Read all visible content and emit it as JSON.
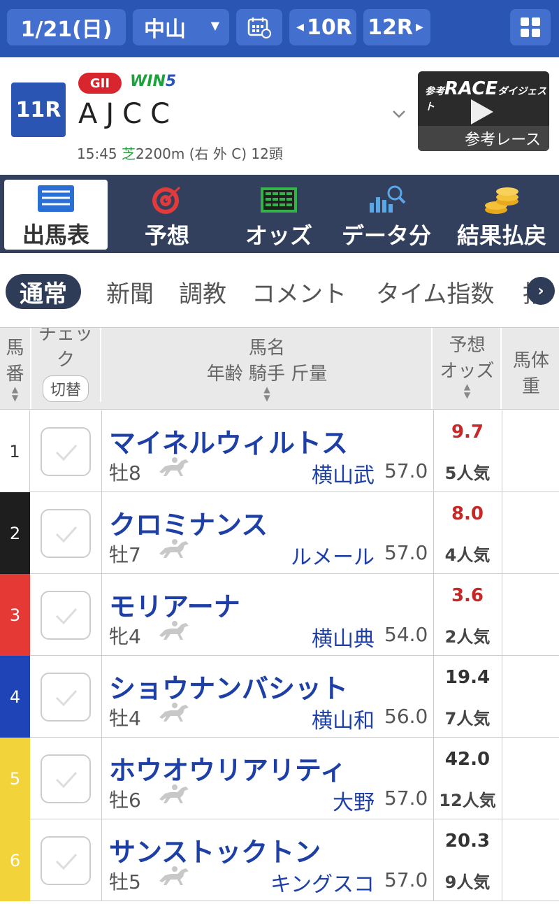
{
  "topbar": {
    "date": "1/21(日)",
    "venue": "中山",
    "prev_race": "10R",
    "next_race": "12R"
  },
  "race": {
    "number": "11R",
    "grade": "GII",
    "win5_prefix": "WIN",
    "win5_num": "5",
    "name": "AJCC",
    "time": "15:45",
    "surface": "芝",
    "info_rest": "2200m (右 外 C) 12頭",
    "thumb_small": "参考",
    "thumb_title": "RACE",
    "thumb_sub": "ダイジェスト",
    "thumb_caption": "参考レース"
  },
  "tabs": [
    "出馬表",
    "予想",
    "オッズ",
    "データ分",
    "結果払戻"
  ],
  "subtabs": [
    "通常",
    "新聞",
    "調教",
    "コメント",
    "タイム指数",
    "指"
  ],
  "table_header": {
    "col1": [
      "馬",
      "番"
    ],
    "col2": [
      "チェッ",
      "ク"
    ],
    "col2_btn": "切替",
    "col3": [
      "馬名",
      "年齢 騎手 斤量"
    ],
    "col4": [
      "予想",
      "オッズ"
    ],
    "col5": [
      "馬体",
      "重"
    ]
  },
  "horses": [
    {
      "num": "1",
      "name": "マイネルウィルトス",
      "sexage": "牡8",
      "jockey": "横山武",
      "weight": "57.0",
      "odds": "9.7",
      "pop": "5人気",
      "hot": true,
      "color": "#ffffff",
      "numcolor": "#333333"
    },
    {
      "num": "2",
      "name": "クロミナンス",
      "sexage": "牡7",
      "jockey": "ルメール",
      "weight": "57.0",
      "odds": "8.0",
      "pop": "4人気",
      "hot": true,
      "color": "#1e1e1e",
      "numcolor": "#ffffff"
    },
    {
      "num": "3",
      "name": "モリアーナ",
      "sexage": "牝4",
      "jockey": "横山典",
      "weight": "54.0",
      "odds": "3.6",
      "pop": "2人気",
      "hot": true,
      "color": "#e53935",
      "numcolor": "#ffffff"
    },
    {
      "num": "4",
      "name": "ショウナンバシット",
      "sexage": "牡4",
      "jockey": "横山和",
      "weight": "56.0",
      "odds": "19.4",
      "pop": "7人気",
      "hot": false,
      "color": "#1e44b8",
      "numcolor": "#ffffff"
    },
    {
      "num": "5",
      "name": "ホウオウリアリティ",
      "sexage": "牡6",
      "jockey": "大野",
      "weight": "57.0",
      "odds": "42.0",
      "pop": "12人気",
      "hot": false,
      "color": "#f2d33a",
      "numcolor": "#ffffff"
    },
    {
      "num": "6",
      "name": "サンストックトン",
      "sexage": "牡5",
      "jockey": "キングスコ",
      "weight": "57.0",
      "odds": "20.3",
      "pop": "9人気",
      "hot": false,
      "color": "#f2d33a",
      "numcolor": "#ffffff"
    }
  ]
}
